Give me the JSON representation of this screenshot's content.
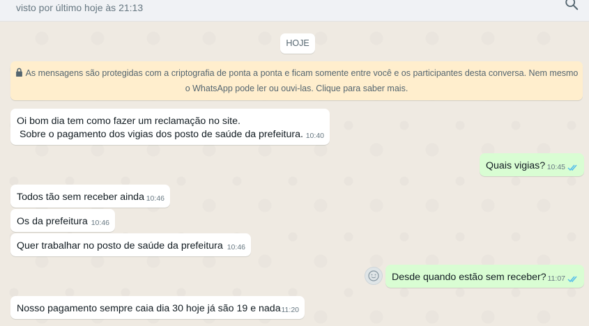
{
  "header": {
    "last_seen": "visto por último hoje às 21:13",
    "search_icon": "search-icon"
  },
  "date_chip": "HOJE",
  "encryption_notice": {
    "line1": "As mensagens são protegidas com a criptografia de ponta a ponta e ficam somente entre você e os participantes desta conversa. Nem mesmo",
    "line2": "o WhatsApp pode ler ou ouvi-las. Clique para saber mais.",
    "icon": "lock-icon"
  },
  "messages": [
    {
      "direction": "in",
      "text": "Oi bom dia tem como fazer um reclamação no site.\n Sobre o pagamento dos vigias dos posto de saúde da prefeitura.",
      "time": "10:40"
    },
    {
      "direction": "out",
      "text": "Quais vigias?",
      "time": "10:45",
      "status": "read"
    },
    {
      "direction": "in",
      "text": "Todos tão sem receber ainda",
      "time": "10:46"
    },
    {
      "direction": "in",
      "text": "Os da prefeitura",
      "time": "10:46"
    },
    {
      "direction": "in",
      "text": "Quer trabalhar no posto de saúde da prefeitura",
      "time": "10:46"
    },
    {
      "direction": "out",
      "text": "Desde quando estão sem receber?",
      "time": "11:07",
      "status": "read"
    },
    {
      "direction": "in",
      "text": "Nosso pagamento sempre caia dia 30 hoje já são 19 e nada",
      "time": "11:20"
    }
  ],
  "colors": {
    "chat_bg": "#efeae2",
    "incoming": "#ffffff",
    "outgoing": "#d9fdd3",
    "encryption_bg": "#ffeecd",
    "read_ticks": "#53bdeb"
  }
}
